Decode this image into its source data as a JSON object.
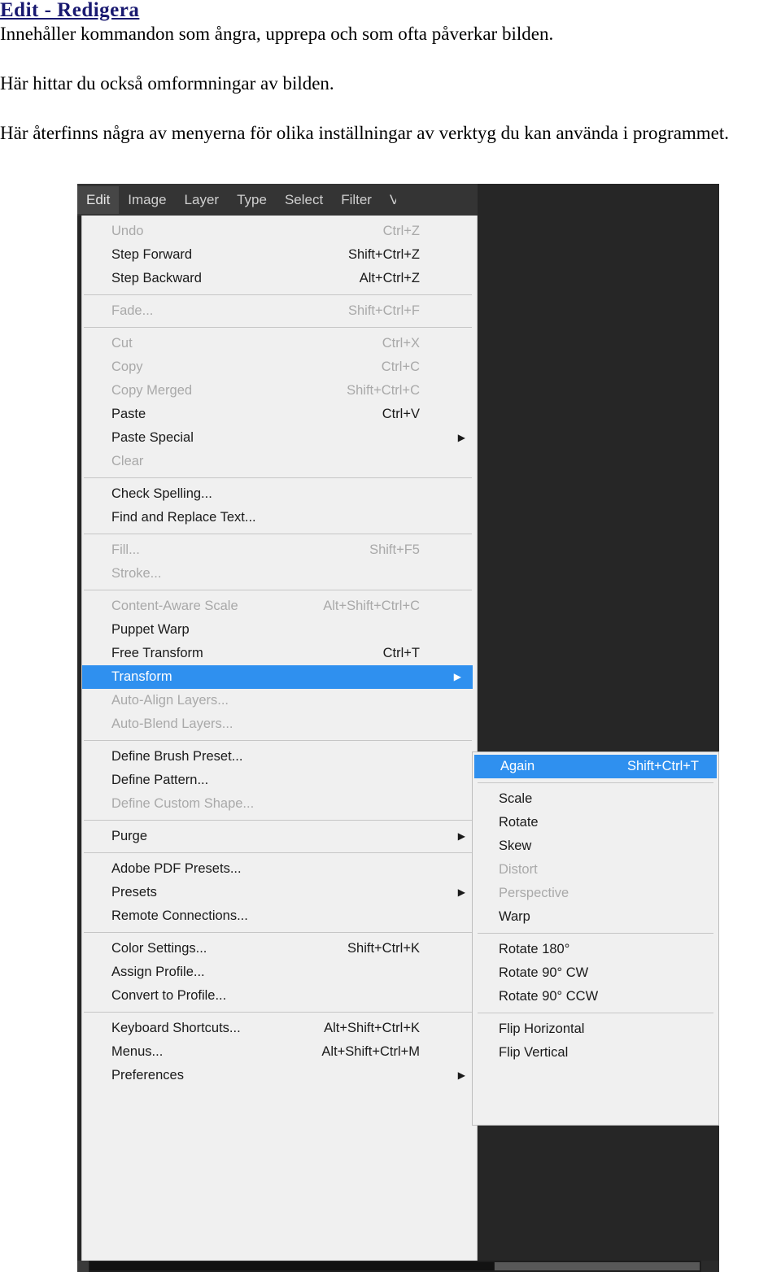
{
  "document": {
    "title": "Edit  -  Redigera",
    "paragraphs": [
      "Innehåller kommandon som ångra, upprepa och som ofta påverkar bilden.",
      "Här hittar du också omformningar av bilden.",
      "Här återfinns några av menyerna för olika inställningar av verktyg du kan använda i programmet."
    ]
  },
  "colors": {
    "title": "#191970",
    "highlight": "#2f90ef",
    "menu_bg": "#f0f0f0",
    "menubar_bg": "#343434",
    "canvas_bg": "#262626",
    "disabled_text": "#a9a9a9"
  },
  "app": {
    "menubar": [
      {
        "label": "Edit",
        "active": true
      },
      {
        "label": "Image",
        "active": false
      },
      {
        "label": "Layer",
        "active": false
      },
      {
        "label": "Type",
        "active": false
      },
      {
        "label": "Select",
        "active": false
      },
      {
        "label": "Filter",
        "active": false
      },
      {
        "label": "V",
        "active": false,
        "clipped": true
      }
    ],
    "edit_menu": [
      {
        "type": "item",
        "label": "Undo",
        "accel": "Ctrl+Z",
        "disabled": true
      },
      {
        "type": "item",
        "label": "Step Forward",
        "accel": "Shift+Ctrl+Z",
        "disabled": false
      },
      {
        "type": "item",
        "label": "Step Backward",
        "accel": "Alt+Ctrl+Z",
        "disabled": false
      },
      {
        "type": "separator"
      },
      {
        "type": "item",
        "label": "Fade...",
        "accel": "Shift+Ctrl+F",
        "disabled": true
      },
      {
        "type": "separator"
      },
      {
        "type": "item",
        "label": "Cut",
        "accel": "Ctrl+X",
        "disabled": true
      },
      {
        "type": "item",
        "label": "Copy",
        "accel": "Ctrl+C",
        "disabled": true
      },
      {
        "type": "item",
        "label": "Copy Merged",
        "accel": "Shift+Ctrl+C",
        "disabled": true
      },
      {
        "type": "item",
        "label": "Paste",
        "accel": "Ctrl+V",
        "disabled": false
      },
      {
        "type": "item",
        "label": "Paste Special",
        "accel": "",
        "submenu": true,
        "disabled": false
      },
      {
        "type": "item",
        "label": "Clear",
        "accel": "",
        "disabled": true
      },
      {
        "type": "separator"
      },
      {
        "type": "item",
        "label": "Check Spelling...",
        "accel": "",
        "disabled": false
      },
      {
        "type": "item",
        "label": "Find and Replace Text...",
        "accel": "",
        "disabled": false
      },
      {
        "type": "separator"
      },
      {
        "type": "item",
        "label": "Fill...",
        "accel": "Shift+F5",
        "disabled": true
      },
      {
        "type": "item",
        "label": "Stroke...",
        "accel": "",
        "disabled": true
      },
      {
        "type": "separator"
      },
      {
        "type": "item",
        "label": "Content-Aware Scale",
        "accel": "Alt+Shift+Ctrl+C",
        "disabled": true
      },
      {
        "type": "item",
        "label": "Puppet Warp",
        "accel": "",
        "disabled": false
      },
      {
        "type": "item",
        "label": "Free Transform",
        "accel": "Ctrl+T",
        "disabled": false
      },
      {
        "type": "item",
        "label": "Transform",
        "accel": "",
        "submenu": true,
        "disabled": false,
        "selected": true
      },
      {
        "type": "item",
        "label": "Auto-Align Layers...",
        "accel": "",
        "disabled": true
      },
      {
        "type": "item",
        "label": "Auto-Blend Layers...",
        "accel": "",
        "disabled": true
      },
      {
        "type": "separator"
      },
      {
        "type": "item",
        "label": "Define Brush Preset...",
        "accel": "",
        "disabled": false
      },
      {
        "type": "item",
        "label": "Define Pattern...",
        "accel": "",
        "disabled": false
      },
      {
        "type": "item",
        "label": "Define Custom Shape...",
        "accel": "",
        "disabled": true
      },
      {
        "type": "separator"
      },
      {
        "type": "item",
        "label": "Purge",
        "accel": "",
        "submenu": true,
        "disabled": false
      },
      {
        "type": "separator"
      },
      {
        "type": "item",
        "label": "Adobe PDF Presets...",
        "accel": "",
        "disabled": false
      },
      {
        "type": "item",
        "label": "Presets",
        "accel": "",
        "submenu": true,
        "disabled": false
      },
      {
        "type": "item",
        "label": "Remote Connections...",
        "accel": "",
        "disabled": false
      },
      {
        "type": "separator"
      },
      {
        "type": "item",
        "label": "Color Settings...",
        "accel": "Shift+Ctrl+K",
        "disabled": false
      },
      {
        "type": "item",
        "label": "Assign Profile...",
        "accel": "",
        "disabled": false
      },
      {
        "type": "item",
        "label": "Convert to Profile...",
        "accel": "",
        "disabled": false
      },
      {
        "type": "separator"
      },
      {
        "type": "item",
        "label": "Keyboard Shortcuts...",
        "accel": "Alt+Shift+Ctrl+K",
        "disabled": false
      },
      {
        "type": "item",
        "label": "Menus...",
        "accel": "Alt+Shift+Ctrl+M",
        "disabled": false
      },
      {
        "type": "item",
        "label": "Preferences",
        "accel": "",
        "submenu": true,
        "disabled": false
      }
    ],
    "transform_submenu": [
      {
        "type": "item",
        "label": "Again",
        "accel": "Shift+Ctrl+T",
        "disabled": false,
        "selected": true
      },
      {
        "type": "separator"
      },
      {
        "type": "item",
        "label": "Scale",
        "accel": "",
        "disabled": false
      },
      {
        "type": "item",
        "label": "Rotate",
        "accel": "",
        "disabled": false
      },
      {
        "type": "item",
        "label": "Skew",
        "accel": "",
        "disabled": false
      },
      {
        "type": "item",
        "label": "Distort",
        "accel": "",
        "disabled": true
      },
      {
        "type": "item",
        "label": "Perspective",
        "accel": "",
        "disabled": true
      },
      {
        "type": "item",
        "label": "Warp",
        "accel": "",
        "disabled": false
      },
      {
        "type": "separator"
      },
      {
        "type": "item",
        "label": "Rotate 180°",
        "accel": "",
        "disabled": false
      },
      {
        "type": "item",
        "label": "Rotate 90° CW",
        "accel": "",
        "disabled": false
      },
      {
        "type": "item",
        "label": "Rotate 90° CCW",
        "accel": "",
        "disabled": false
      },
      {
        "type": "separator"
      },
      {
        "type": "item",
        "label": "Flip Horizontal",
        "accel": "",
        "disabled": false
      },
      {
        "type": "item",
        "label": "Flip Vertical",
        "accel": "",
        "disabled": false
      }
    ],
    "icons": {
      "submenu_arrow": "▶"
    }
  }
}
